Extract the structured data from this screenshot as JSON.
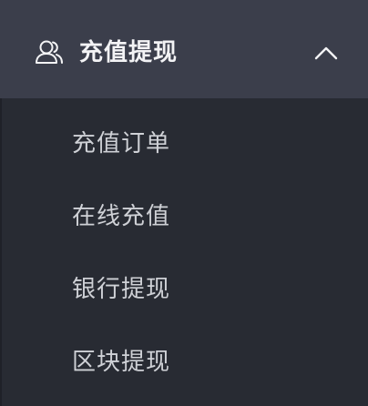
{
  "menu": {
    "header": {
      "label": "充值提现",
      "icon": "user-icon",
      "toggle_icon": "chevron-up-icon",
      "expanded": true
    },
    "items": [
      {
        "label": "充值订单"
      },
      {
        "label": "在线充值"
      },
      {
        "label": "银行提现"
      },
      {
        "label": "区块提现"
      }
    ]
  },
  "colors": {
    "header_bg": "#3b3e4b",
    "submenu_bg": "#282b33",
    "header_text": "#f3f3f5",
    "item_text": "#cfd1d6"
  }
}
